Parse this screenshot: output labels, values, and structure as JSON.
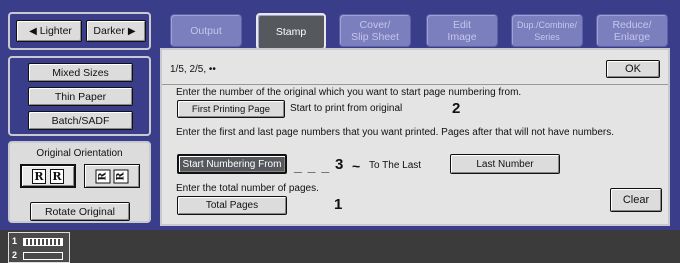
{
  "left_panel": {
    "lighter_label": "Lighter",
    "darker_label": "Darker",
    "mixed_sizes_label": "Mixed Sizes",
    "thin_paper_label": "Thin Paper",
    "batch_sadf_label": "Batch/SADF",
    "orientation_label": "Original Orientation",
    "rotate_original_label": "Rotate Original",
    "orientation_glyph_a": "R",
    "orientation_glyph_b": "R"
  },
  "tabs": [
    {
      "label": "Output",
      "active": false
    },
    {
      "label": "Stamp",
      "active": true
    },
    {
      "label": "Cover/\nSlip Sheet",
      "active": false
    },
    {
      "label": "Edit\nImage",
      "active": false
    },
    {
      "label": "Dup./Combine/\nSeries",
      "active": false
    },
    {
      "label": "Reduce/\nEnlarge",
      "active": false
    }
  ],
  "content": {
    "mode_title": "1/5, 2/5, ••",
    "ok_label": "OK",
    "instruction_1": "Enter the number of the original which you want to start page numbering from.",
    "first_printing_label": "First Printing Page",
    "start_print_text": "Start to print from original",
    "first_printing_value": "2",
    "instruction_2": "Enter the first and last page numbers that you want printed. Pages after that will not have numbers.",
    "start_numbering_label": "Start Numbering From",
    "start_numbering_value": "3",
    "dashes": "_ _ _",
    "tilde": "~",
    "to_last_text": "To The Last",
    "last_number_label": "Last Number",
    "instruction_3": "Enter the total number of  pages.",
    "total_pages_label": "Total Pages",
    "total_pages_value": "1",
    "clear_label": "Clear"
  },
  "bottom": {
    "job_1": "1",
    "job_2": "2"
  },
  "colors": {
    "background": "#3a3d8a",
    "tab_inactive": "#7c7fbe",
    "tab_active": "#55585c",
    "panel": "#e4e4e4"
  }
}
